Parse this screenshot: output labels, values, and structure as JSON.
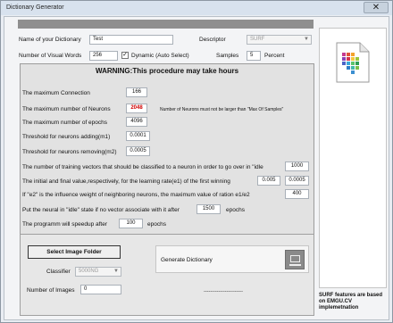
{
  "window": {
    "title": "Dictionary Generator",
    "close_glyph": "✕"
  },
  "form": {
    "name_label": "Name of your Dictionary",
    "name_value": "Test",
    "descriptor_label": "Descriptor",
    "descriptor_value": "SURF",
    "visual_words_label": "Number of Visual Words",
    "visual_words_value": "256",
    "dynamic_label": "Dynamic (Auto Select)",
    "dynamic_checked": true,
    "samples_label": "Samples",
    "samples_value": "5",
    "percent_label": "Percent"
  },
  "warning": {
    "title": "WARNING:This procedure may take hours",
    "max_connection_label": "The maximum Connection",
    "max_connection_value": "166",
    "max_neurons_label": "The maximum number of Neurons",
    "max_neurons_value": "2048",
    "neurons_note": "Number of Neurons must not be larger than \"Max Of Samples\"",
    "max_epochs_label": "The maximum number of epochs",
    "max_epochs_value": "4096",
    "threshold_add_label": "Threshold for neurons adding(m1)",
    "threshold_add_value": "0.0001",
    "threshold_remove_label": "Threshold for neurons removing(m2)",
    "threshold_remove_value": "0.0005",
    "training_vectors_label": "The number of training vectors that should be classified to a neuron in order to go over in \"idle",
    "training_vectors_value": "1000",
    "learning_rate_label": "The initial and final value,respectively, for the learning rate(e1) of the first winning",
    "learning_rate_initial": "0.005",
    "learning_rate_final": "0.0005",
    "influence_label": "If \"e2\" is the influence weight of neighboring neurons, the maximum value of ration e1/e2",
    "influence_value": "400",
    "idle_prefix": "Put the neural in \"idle\" state if no vector associate with it after",
    "idle_value": "1500",
    "idle_suffix": "epochs",
    "speedup_prefix": "The programm will speedup after",
    "speedup_value": "100",
    "speedup_suffix": "epochs"
  },
  "bottom": {
    "select_folder_label": "Select Image Folder",
    "classifier_label": "Classifier",
    "classifier_value": "5000NG",
    "num_images_label": "Number of Images",
    "num_images_value": "0",
    "generate_label": "Generate Dictionary",
    "status_dashes": "------------------------"
  },
  "side": {
    "icon_name": "dictionary-document-icon",
    "note": "SURF features are based on EMGU.CV implemetnation"
  },
  "colors": {
    "neurons_value": "#d00000",
    "panel_bg": "#e2e2e2",
    "top_bar": "#8f8f8f"
  }
}
